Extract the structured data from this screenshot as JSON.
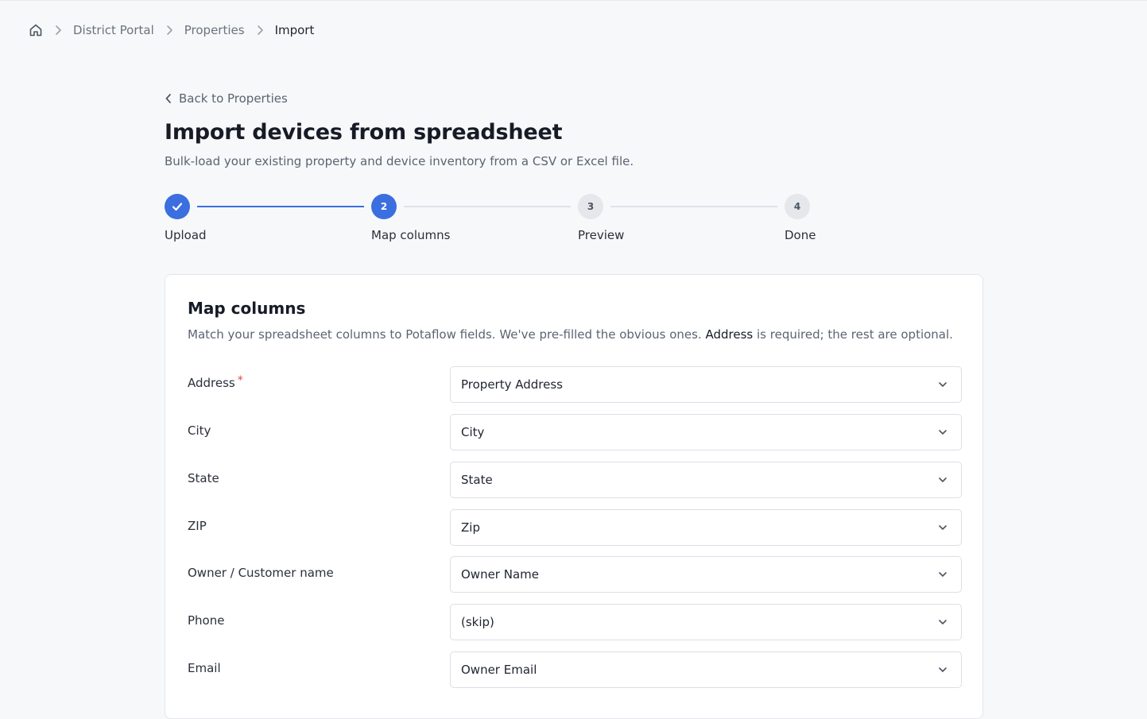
{
  "breadcrumb": {
    "items": [
      "District Portal",
      "Properties",
      "Import"
    ]
  },
  "back_link": "Back to Properties",
  "page": {
    "title": "Import devices from spreadsheet",
    "subtitle": "Bulk-load your existing property and device inventory from a CSV or Excel file."
  },
  "stepper": {
    "steps": [
      {
        "number": "1",
        "label": "Upload",
        "state": "done"
      },
      {
        "number": "2",
        "label": "Map columns",
        "state": "active"
      },
      {
        "number": "3",
        "label": "Preview",
        "state": "todo"
      },
      {
        "number": "4",
        "label": "Done",
        "state": "todo"
      }
    ]
  },
  "card": {
    "title": "Map columns",
    "desc_before": "Match your spreadsheet columns to Potaflow fields. We've pre-filled the obvious ones. ",
    "desc_strong": "Address",
    "desc_after": " is required; the rest are optional.",
    "required_mark": "*",
    "fields": [
      {
        "label": "Address",
        "value": "Property Address",
        "required": true
      },
      {
        "label": "City",
        "value": "City",
        "required": false
      },
      {
        "label": "State",
        "value": "State",
        "required": false
      },
      {
        "label": "ZIP",
        "value": "Zip",
        "required": false
      },
      {
        "label": "Owner / Customer name",
        "value": "Owner Name",
        "required": false
      },
      {
        "label": "Phone",
        "value": "(skip)",
        "required": false
      },
      {
        "label": "Email",
        "value": "Owner Email",
        "required": false
      }
    ]
  },
  "colors": {
    "accent": "#3b6fe0",
    "required": "#e0463a"
  },
  "icons": {
    "home": "home-icon",
    "separator": "chevron-right-icon",
    "back": "chevron-left-icon",
    "check": "check-icon",
    "dropdown": "chevron-down-icon"
  }
}
